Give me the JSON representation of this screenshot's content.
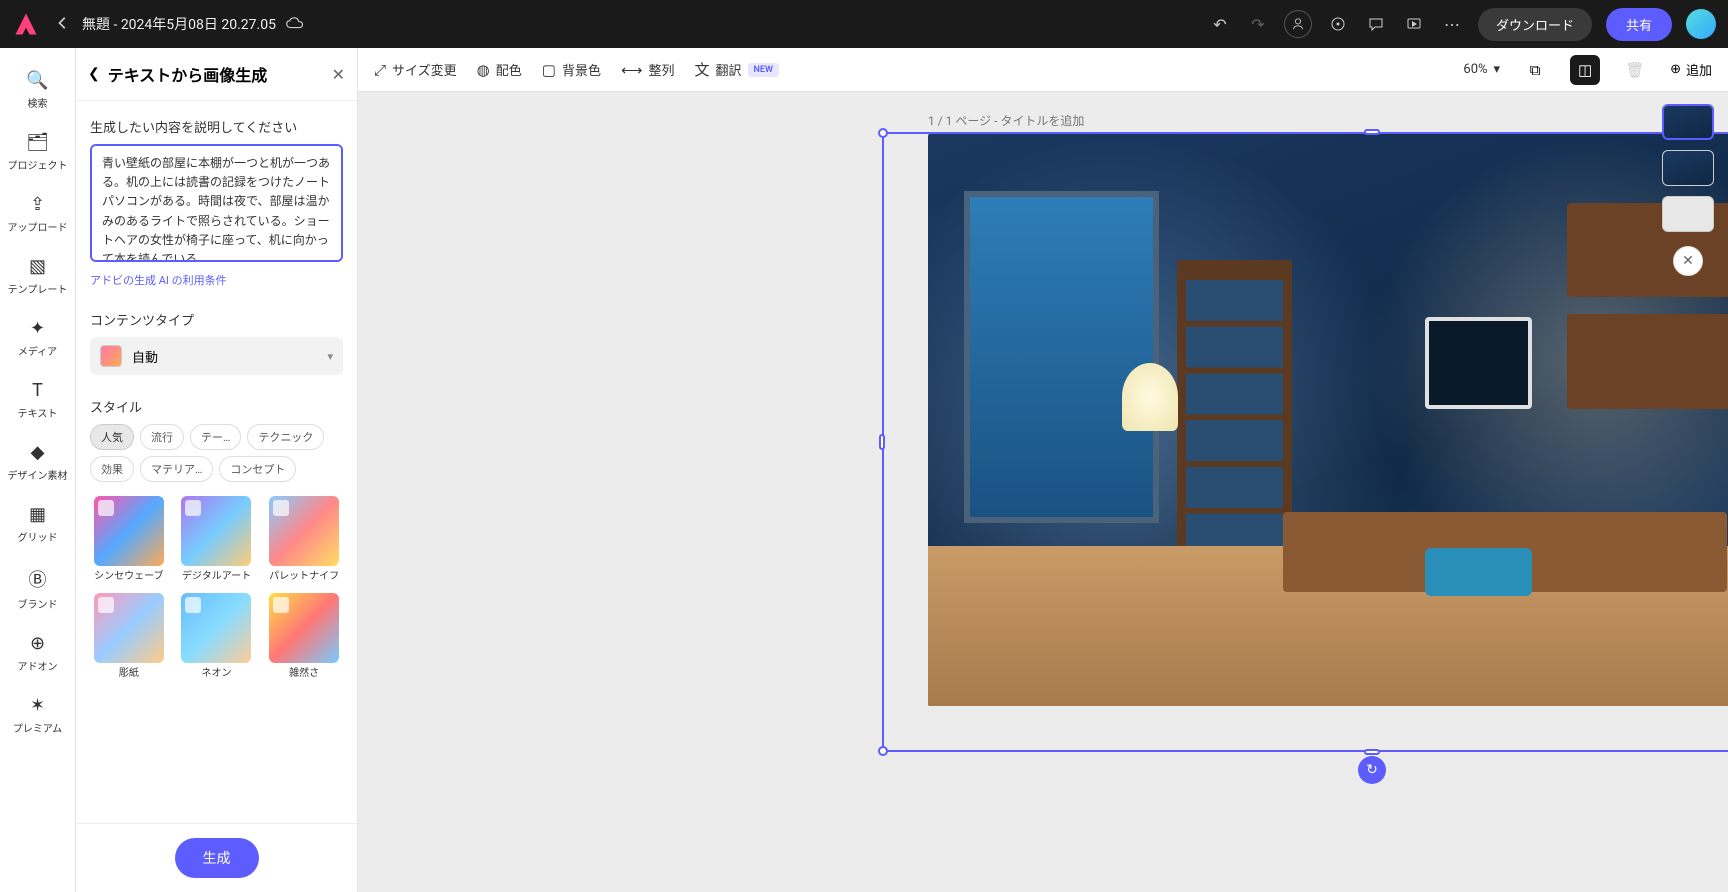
{
  "header": {
    "doc_title": "無題 - 2024年5月08日 20.27.05",
    "download": "ダウンロード",
    "share": "共有"
  },
  "rail": {
    "search": "検索",
    "projects": "プロジェクト",
    "upload": "アップロード",
    "templates": "テンプレート",
    "media": "メディア",
    "text": "テキスト",
    "design": "デザイン素材",
    "grid": "グリッド",
    "brand": "ブランド",
    "addon": "アドオン",
    "premium": "プレミアム"
  },
  "panel": {
    "title": "テキストから画像生成",
    "desc_label": "生成したい内容を説明してください",
    "prompt": "青い壁紙の部屋に本棚が一つと机が一つある。机の上には読書の記録をつけたノートパソコンがある。時間は夜で、部屋は温かみのあるライトで照らされている。ショートヘアの女性が椅子に座って、机に向かって本を読んでいる。",
    "terms": "アドビの生成 AI の利用条件",
    "content_type_label": "コンテンツタイプ",
    "content_type_value": "自動",
    "style_label": "スタイル",
    "pills": {
      "popular": "人気",
      "trend": "流行",
      "theme": "テー…",
      "technique": "テクニック",
      "effect": "効果",
      "material": "マテリア…",
      "concept": "コンセプト"
    },
    "styles": {
      "s1": "シンセウェーブ",
      "s2": "デジタルアート",
      "s3": "パレットナイフ",
      "s4": "彫紙",
      "s5": "ネオン",
      "s6": "雑然さ"
    },
    "generate": "生成"
  },
  "toolbar": {
    "resize": "サイズ変更",
    "recolor": "配色",
    "bgcolor": "背景色",
    "arrange": "整列",
    "translate": "翻訳",
    "new": "NEW",
    "zoom": "60%",
    "add": "追加"
  },
  "canvas": {
    "page_label": "1 / 1 ページ - タイトルを追加"
  }
}
